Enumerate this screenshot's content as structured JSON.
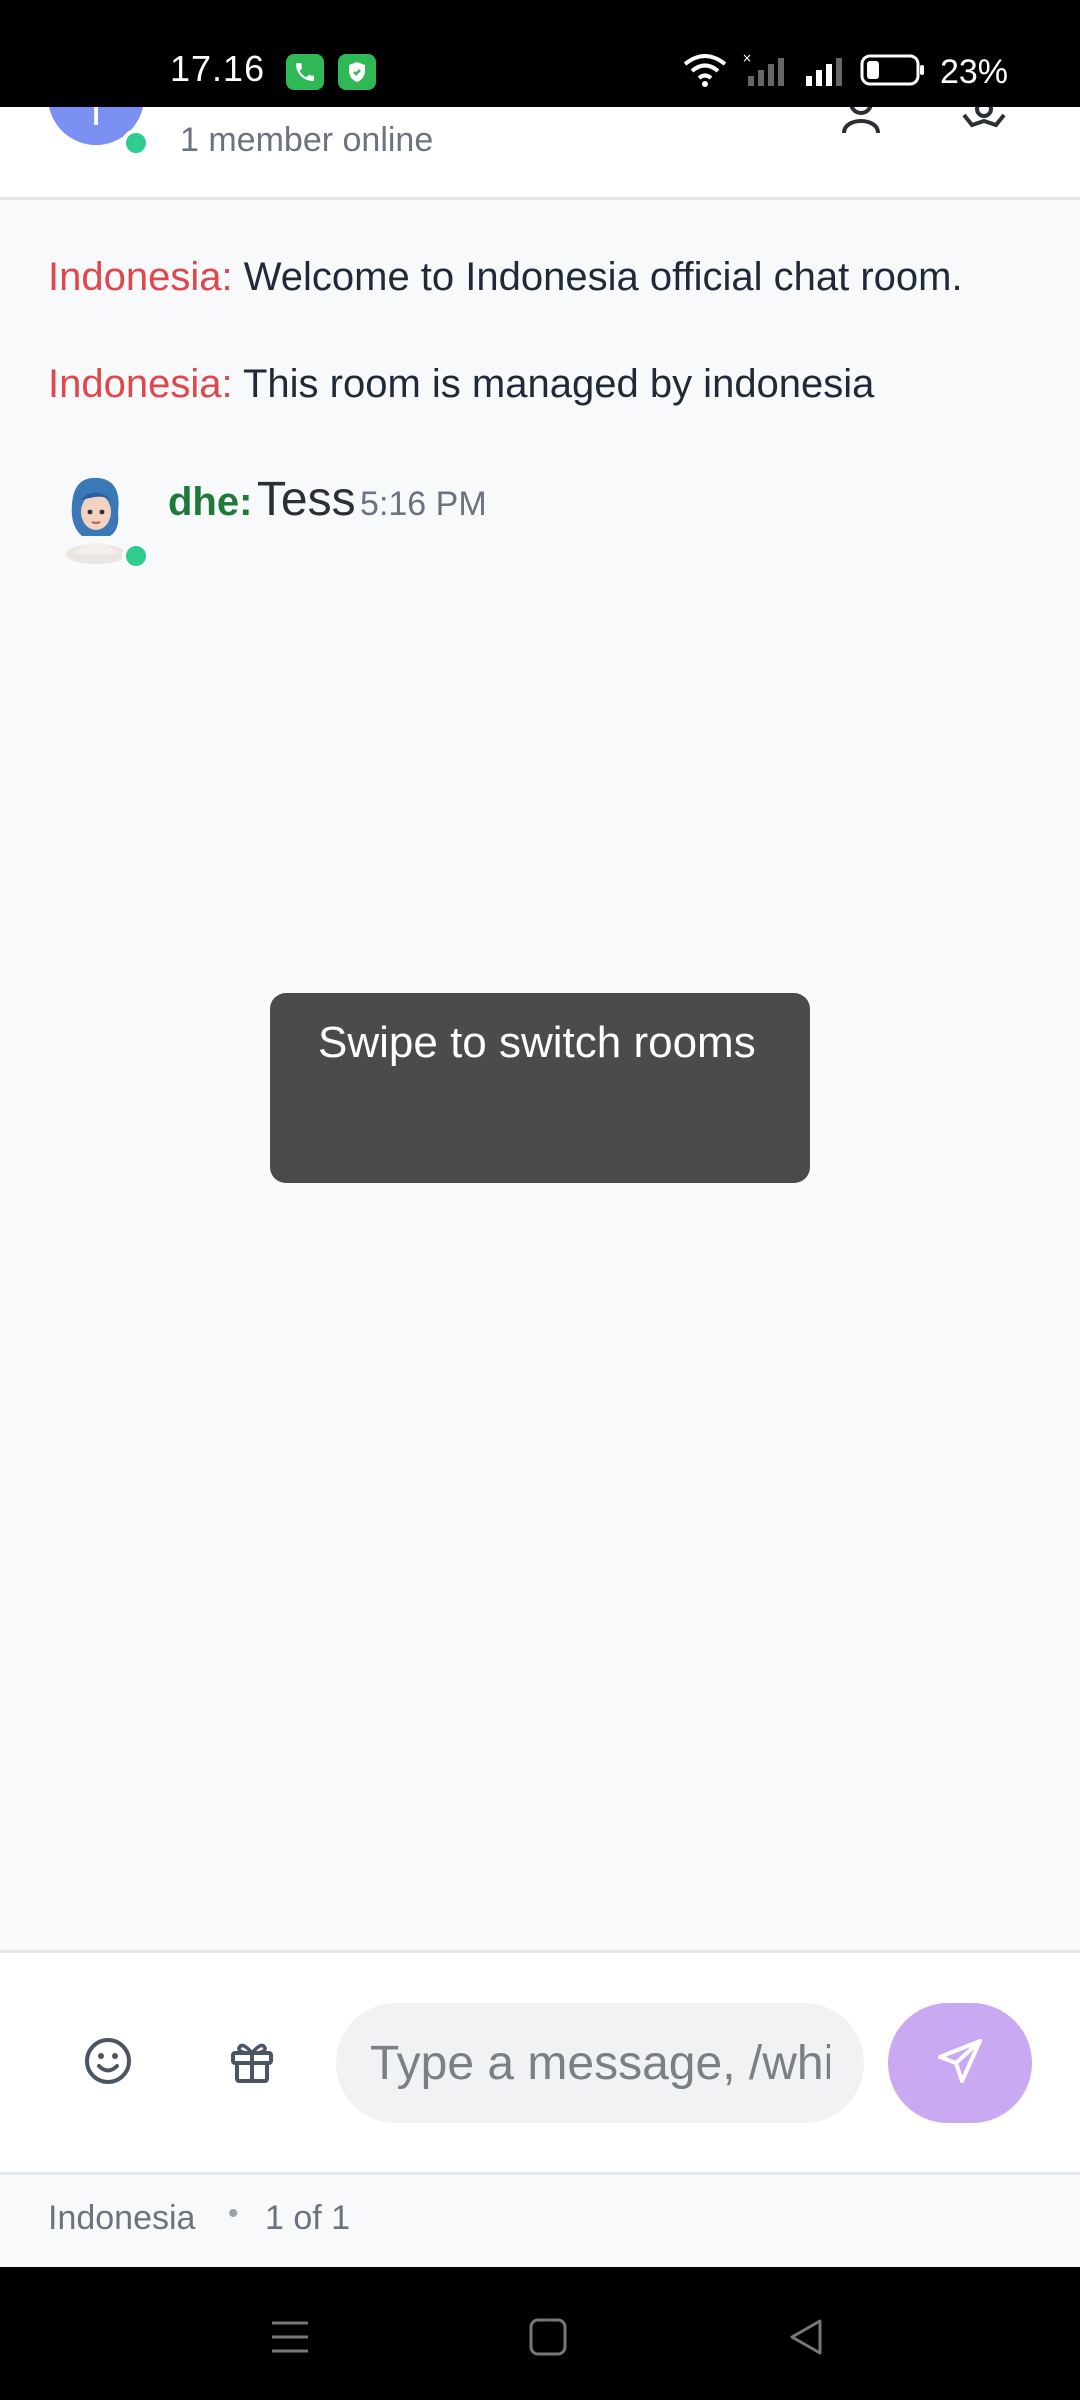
{
  "status_bar": {
    "time": "17.16",
    "battery": "23%",
    "icons": [
      "phone-icon",
      "shield-icon",
      "wifi-icon",
      "signal-icon",
      "battery-icon"
    ]
  },
  "header": {
    "avatar_initial": "I",
    "member_status": "1 member online",
    "icons": [
      "members-icon",
      "settings-icon"
    ]
  },
  "messages": {
    "system": [
      {
        "sender": "Indonesia:",
        "text": "Welcome to Indonesia official chat room."
      },
      {
        "sender": "Indonesia:",
        "text": "This room is managed by indonesia"
      }
    ],
    "chat": [
      {
        "sender": "dhe:",
        "text": "Tess",
        "time": "5:16 PM"
      }
    ]
  },
  "toast": {
    "text": "Swipe to switch rooms"
  },
  "composer": {
    "placeholder": "Type a message, /whisper",
    "icons": [
      "emoji-icon",
      "gift-icon",
      "send-icon"
    ]
  },
  "footer": {
    "room_name": "Indonesia",
    "separator": "•",
    "page": "1 of 1"
  },
  "colors": {
    "system_sender": "#e0474c",
    "chat_sender": "#1f7a3a",
    "online_dot": "#2ecc8f",
    "send_button": "#c9a9f2",
    "toast_bg": "#4a4b4b"
  }
}
